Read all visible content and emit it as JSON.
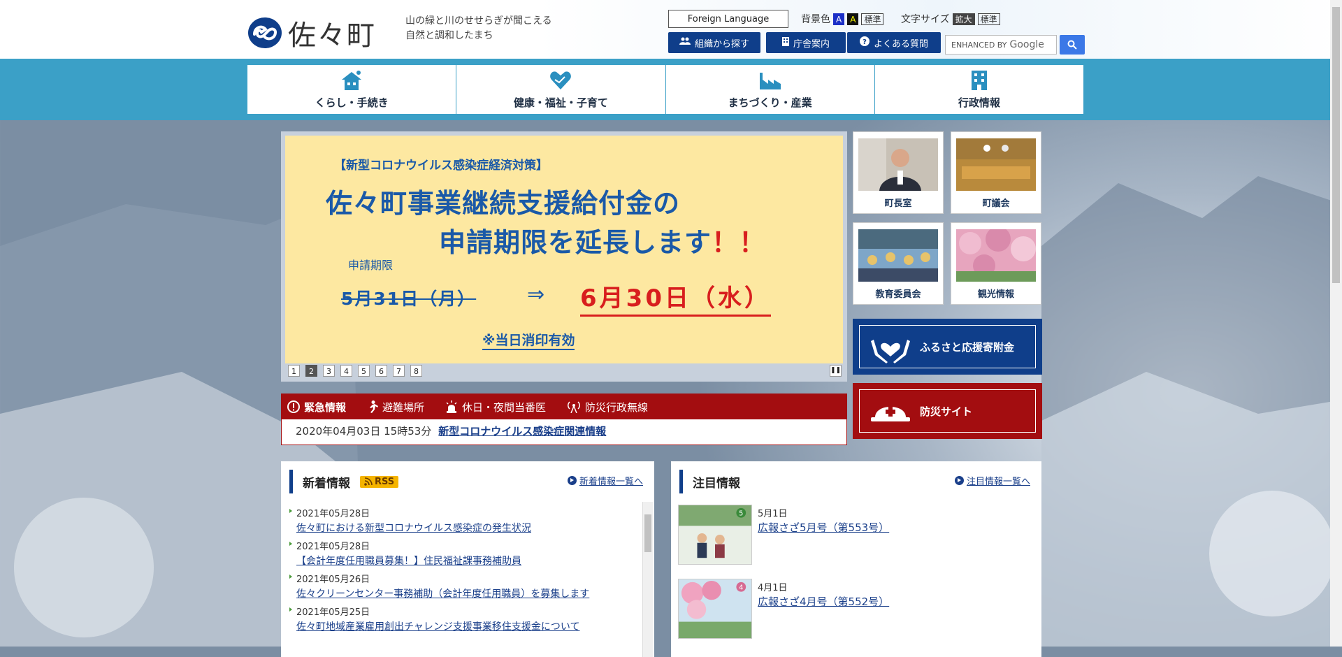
{
  "header": {
    "logo_text": "佐々町",
    "tagline_line1": "山の緑と川のせせらぎが聞こえる",
    "tagline_line2": "自然と調和したまち",
    "foreign_language": "Foreign Language",
    "bgcolor_label": "背景色",
    "bg_opt1": "A",
    "bg_opt2": "A",
    "bg_standard": "標準",
    "fontsize_label": "文字サイズ",
    "fs_enlarge": "拡大",
    "fs_standard": "標準",
    "btn_org": "組織から探す",
    "btn_office": "庁舎案内",
    "btn_faq": "よくある質問",
    "search_placeholder": "ENHANCED BY",
    "search_brand": "Google"
  },
  "mainnav": [
    {
      "label": "くらし・手続き"
    },
    {
      "label": "健康・福祉・子育て"
    },
    {
      "label": "まちづくり・産業"
    },
    {
      "label": "行政情報"
    }
  ],
  "slide": {
    "subtitle": "【新型コロナウイルス感染症経済対策】",
    "title1": "佐々町事業継続支援給付金の",
    "title2": "申請期限を延長します",
    "title2_ex": "！！",
    "label": "申請期限",
    "old_date": "5月31日（月）",
    "arrow": "⇒",
    "new_date": "6月30日（水）",
    "note": "※当日消印有効",
    "pages": [
      "1",
      "2",
      "3",
      "4",
      "5",
      "6",
      "7",
      "8"
    ],
    "active_page": "2"
  },
  "thumbs": [
    {
      "label": "町長室"
    },
    {
      "label": "町議会"
    },
    {
      "label": "教育委員会"
    },
    {
      "label": "観光情報"
    }
  ],
  "banners": {
    "furusato": "ふるさと応援寄附金",
    "bousai": "防災サイト"
  },
  "emergency": {
    "tabs": [
      "緊急情報",
      "避難場所",
      "休日・夜間当番医",
      "防災行政無線"
    ],
    "date": "2020年04月03日 15時53分",
    "link": "新型コロナウイルス感染症関連情報"
  },
  "news": {
    "title": "新着情報",
    "rss": "RSS",
    "more": "新着情報一覧へ",
    "items": [
      {
        "date": "2021年05月28日",
        "title": "佐々町における新型コロナウイルス感染症の発生状況"
      },
      {
        "date": "2021年05月28日",
        "title": "【会計年度任用職員募集！】住民福祉課事務補助員"
      },
      {
        "date": "2021年05月26日",
        "title": "佐々クリーンセンター事務補助（会計年度任用職員）を募集します"
      },
      {
        "date": "2021年05月25日",
        "title": "佐々町地域産業雇用創出チャレンジ支援事業移住支援金について"
      }
    ]
  },
  "featured": {
    "title": "注目情報",
    "more": "注目情報一覧へ",
    "items": [
      {
        "date": "5月1日",
        "title": "広報さざ5月号（第553号）",
        "badge": "5"
      },
      {
        "date": "4月1日",
        "title": "広報さざ4月号（第552号）",
        "badge": "4"
      }
    ]
  },
  "colors": {
    "navy": "#0f3e8a",
    "nav_bar": "#3ba0c7",
    "emergency_red": "#a30d10",
    "slide_bg": "#fde8a1"
  }
}
